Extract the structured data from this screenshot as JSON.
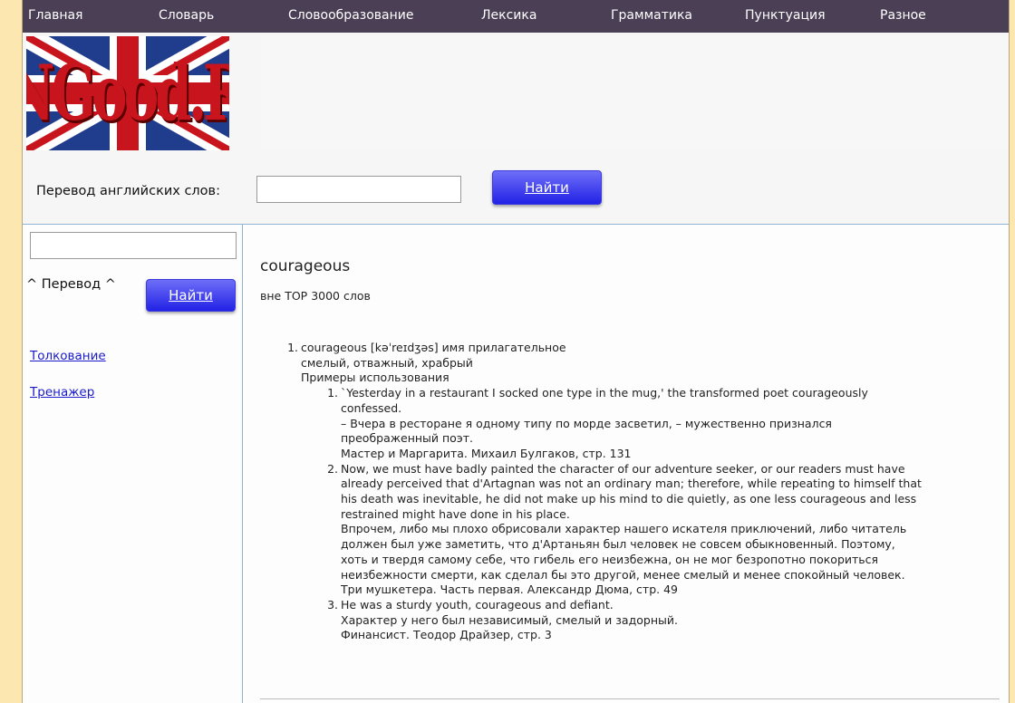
{
  "nav": {
    "items": [
      "Главная",
      "Словарь",
      "Словообразование",
      "Лексика",
      "Грамматика",
      "Пунктуация",
      "Разное"
    ]
  },
  "logo": {
    "text": "ENGood.RU"
  },
  "search": {
    "label": "Перевод английских слов:",
    "value": "",
    "button": "Найти"
  },
  "sidebar": {
    "input_value": "",
    "perevod_label": "^ Перевод ^",
    "button": "Найти",
    "links": [
      "Толкование",
      "Тренажер"
    ]
  },
  "article": {
    "word": "courageous",
    "frequency": "вне TOP 3000 слов",
    "sense_number": "1.",
    "sense_header": "courageous [kəˈreɪdʒəs] имя прилагательное",
    "translation": "смелый, отважный, храбрый",
    "examples_label": "Примеры использования",
    "examples": [
      {
        "number": "1.",
        "lines": [
          "`Yesterday in a restaurant I socked one type in the mug,' the transformed poet courageously",
          "confessed.",
          "– Вчера в ресторане я одному типу по морде засветил, – мужественно признался",
          "преображенный поэт.",
          "Мастер и Маргарита. Михаил Булгаков, стр. 131"
        ]
      },
      {
        "number": "2.",
        "lines": [
          "Now, we must have badly painted the character of our adventure seeker, or our readers must have",
          "already perceived that d'Artagnan was not an ordinary man; therefore, while repeating to himself that",
          "his death was inevitable, he did not make up his mind to die quietly, as one less courageous and less",
          "restrained might have done in his place.",
          "Впрочем, либо мы плохо обрисовали характер нашего искателя приключений, либо читатель",
          "должен был уже заметить, что д'Артаньян был человек не совсем обыкновенный. Поэтому,",
          "хоть и твердя самому себе, что гибель его неизбежна, он не мог безропотно покориться",
          "неизбежности смерти, как сделал бы это другой, менее смелый и менее спокойный человек.",
          "Три мушкетера. Часть первая. Александр Дюма, стр. 49"
        ]
      },
      {
        "number": "3.",
        "lines": [
          "He was a sturdy youth, courageous and defiant.",
          "Характер у него был независимый, смелый и задорный.",
          "Финансист. Теодор Драйзер, стр. 3"
        ]
      }
    ]
  },
  "colors": {
    "outer_background": "#fde7b0",
    "nav_background": "#4a3f55",
    "button_gradient_top": "#6e6ef8",
    "button_gradient_bottom": "#2222e6",
    "link": "#1a1acc",
    "frame_border": "#8fb4d4"
  }
}
